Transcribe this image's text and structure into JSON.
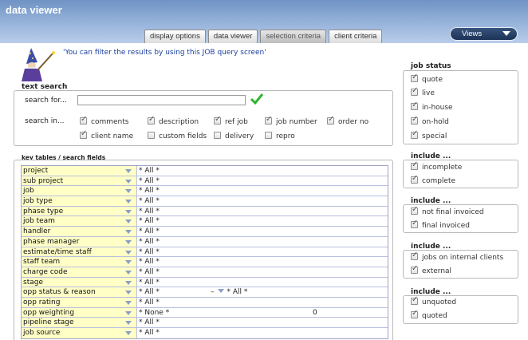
{
  "app": {
    "title": "data viewer"
  },
  "tabs": [
    {
      "label": "display options"
    },
    {
      "label": "data viewer"
    },
    {
      "label": "selection criteria"
    },
    {
      "label": "client criteria"
    }
  ],
  "views_button": {
    "label": "Views"
  },
  "hint": {
    "text": "'You can filter the results by using this JOB query screen'"
  },
  "text_search": {
    "title": "text search",
    "search_for_label": "search for...",
    "search_for_value": "",
    "search_in_label": "search in...",
    "options": [
      {
        "label": "comments",
        "checked": true
      },
      {
        "label": "description",
        "checked": true
      },
      {
        "label": "ref job",
        "checked": true
      },
      {
        "label": "job number",
        "checked": true
      },
      {
        "label": "order no",
        "checked": true
      },
      {
        "label": "client name",
        "checked": true
      },
      {
        "label": "custom fields",
        "checked": false
      },
      {
        "label": "delivery",
        "checked": false
      },
      {
        "label": "repro",
        "checked": false
      }
    ]
  },
  "key_tables": {
    "title": "key tables / search fields",
    "rows": [
      {
        "key": "project",
        "value": "* All *"
      },
      {
        "key": "sub project",
        "value": "* All *"
      },
      {
        "key": "job",
        "value": "* All *"
      },
      {
        "key": "job type",
        "value": "* All *"
      },
      {
        "key": "phase type",
        "value": "* All *"
      },
      {
        "key": "job team",
        "value": "* All *"
      },
      {
        "key": "handler",
        "value": "* All *"
      },
      {
        "key": "phase manager",
        "value": "* All *"
      },
      {
        "key": "estimate/time staff",
        "value": "* All *"
      },
      {
        "key": "staff team",
        "value": "* All *"
      },
      {
        "key": "charge code",
        "value": "* All *"
      },
      {
        "key": "stage",
        "value": "* All *"
      },
      {
        "key": "opp status & reason",
        "value": "* All *",
        "extra_prefix": "–",
        "extra_value": "* All *"
      },
      {
        "key": "opp rating",
        "value": "* All *"
      },
      {
        "key": "opp weighting",
        "value": "* None *",
        "extra_number": "0"
      },
      {
        "key": "pipeline stage",
        "value": "* All *"
      },
      {
        "key": "job source",
        "value": "* All *"
      }
    ]
  },
  "job_status": {
    "title": "job status",
    "items": [
      {
        "label": "quote",
        "checked": true
      },
      {
        "label": "live",
        "checked": true
      },
      {
        "label": "in-house",
        "checked": true
      },
      {
        "label": "on-hold",
        "checked": true
      },
      {
        "label": "special",
        "checked": true
      }
    ]
  },
  "include_groups": [
    {
      "title": "include ...",
      "items": [
        {
          "label": "incomplete",
          "checked": true
        },
        {
          "label": "complete",
          "checked": true
        }
      ]
    },
    {
      "title": "include ...",
      "items": [
        {
          "label": "not final invoiced",
          "checked": true
        },
        {
          "label": "final invoiced",
          "checked": true
        }
      ]
    },
    {
      "title": "include ...",
      "items": [
        {
          "label": "jobs on internal clients",
          "checked": true
        },
        {
          "label": "external",
          "checked": true
        }
      ]
    },
    {
      "title": "include ...",
      "items": [
        {
          "label": "unquoted",
          "checked": true
        },
        {
          "label": "quoted",
          "checked": true
        }
      ]
    }
  ],
  "colors": {
    "header_top": "#6f93c4",
    "key_cell": "#ffffc6",
    "hint_text": "#1c3fa0",
    "check_green": "#2fb52f"
  }
}
